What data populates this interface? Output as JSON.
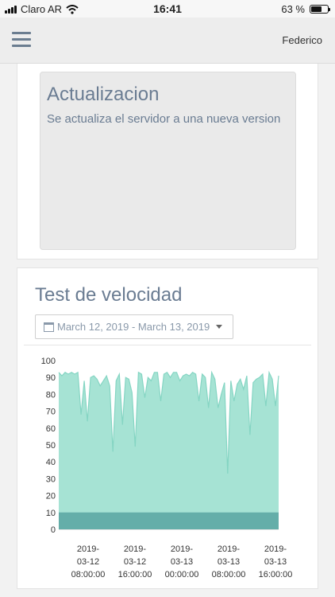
{
  "status_bar": {
    "carrier": "Claro AR",
    "time": "16:41",
    "battery_text": "63 %",
    "battery_level": 0.63,
    "icons": [
      "signal-icon",
      "wifi-icon",
      "battery-icon"
    ]
  },
  "navbar": {
    "menu_icon": "hamburger-icon",
    "user": "Federico"
  },
  "update_card": {
    "title": "Actualizacion",
    "text": "Se actualiza el servidor a una nueva version"
  },
  "speed_card": {
    "title": "Test de velocidad",
    "date_range": "March 12, 2019 - March 13, 2019",
    "icons": [
      "calendar-icon",
      "caret-down-icon"
    ]
  },
  "colors": {
    "area_upper": "#a6e3d4",
    "area_upper_stroke": "#85d5c3",
    "area_lower": "#64aea9",
    "title": "#6a7c92"
  },
  "chart_data": {
    "type": "area",
    "ylim": [
      0,
      100
    ],
    "yticks": [
      0,
      10,
      20,
      30,
      40,
      50,
      60,
      70,
      80,
      90,
      100
    ],
    "x_ticks": [
      {
        "date": "2019-03-12",
        "time": "08:00:00"
      },
      {
        "date": "2019-03-12",
        "time": "16:00:00"
      },
      {
        "date": "2019-03-13",
        "time": "00:00:00"
      },
      {
        "date": "2019-03-13",
        "time": "08:00:00"
      },
      {
        "date": "2019-03-13",
        "time": "16:00:00"
      }
    ],
    "series": [
      {
        "values": [
          93,
          91,
          93,
          92,
          93,
          92,
          93,
          68,
          88,
          64,
          90,
          91,
          89,
          85,
          88,
          91,
          85,
          46,
          88,
          92,
          62,
          90,
          89,
          81,
          49,
          93,
          92,
          78,
          90,
          88,
          93,
          93,
          76,
          92,
          93,
          90,
          93,
          93,
          88,
          91,
          92,
          91,
          93,
          92,
          76,
          92,
          90,
          72,
          93,
          89,
          72,
          80,
          87,
          33,
          88,
          76,
          86,
          89,
          83,
          91,
          56,
          87,
          89,
          90,
          92,
          73,
          93,
          89,
          73,
          91
        ]
      },
      {
        "values": [
          10,
          10,
          10,
          10,
          10,
          10,
          10,
          10,
          10,
          10,
          10,
          10,
          10,
          10,
          10,
          10,
          10,
          10,
          10,
          10,
          10,
          10,
          10,
          10,
          10,
          10,
          10,
          10,
          10,
          10,
          10,
          10,
          10,
          10,
          10,
          10,
          10,
          10,
          10,
          10,
          10,
          10,
          10,
          10,
          10,
          10,
          10,
          10,
          10,
          10,
          10,
          10,
          10,
          10,
          10,
          10,
          10,
          10,
          10,
          10,
          10,
          10,
          10,
          10,
          10,
          10,
          10,
          10,
          10,
          10
        ]
      }
    ]
  }
}
